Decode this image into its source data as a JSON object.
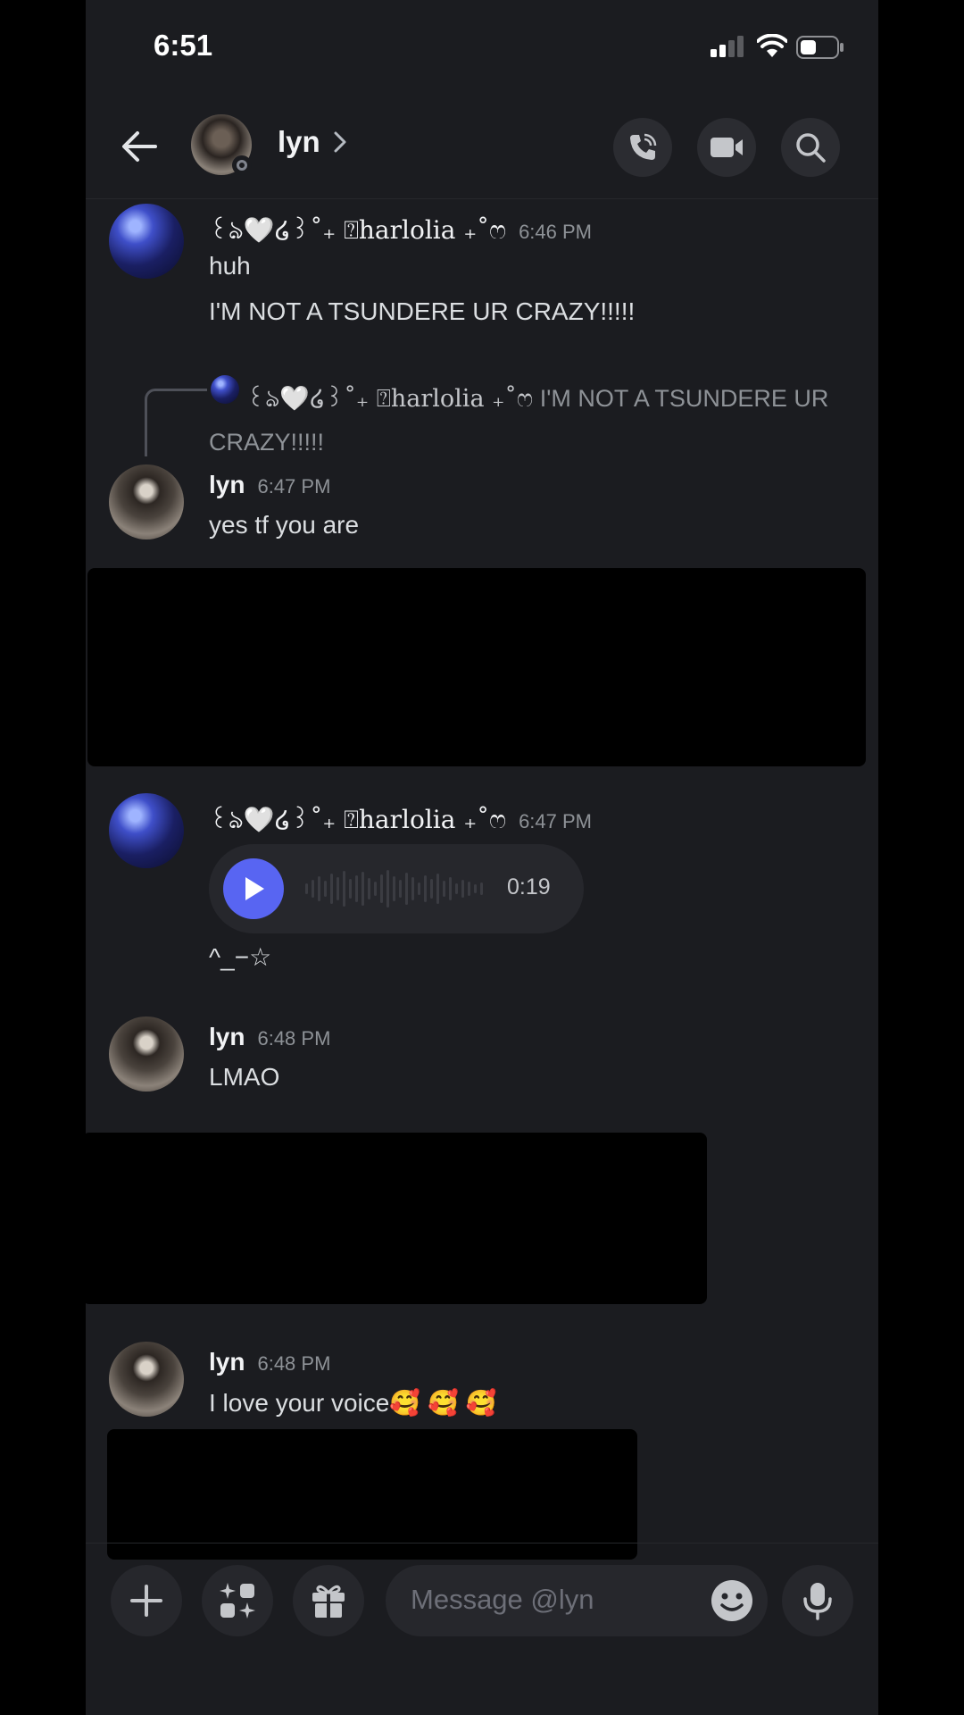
{
  "status_bar": {
    "time": "6:51"
  },
  "header": {
    "name": "lyn"
  },
  "messages": [
    {
      "author": "꒰ঌ🤍໒꒱˚₊ ⍰harlolia ₊˚ෆ",
      "time": "6:46 PM",
      "lines": [
        "huh",
        "I'M NOT A TSUNDERE UR CRAZY!!!!!"
      ]
    },
    {
      "reply_to": {
        "author": "꒰ঌ🤍໒꒱˚₊ ⍰harlolia ₊˚ෆ",
        "text": "I'M NOT A TSUNDERE UR CRAZY!!!!!"
      },
      "author": "lyn",
      "time": "6:47 PM",
      "lines": [
        "yes tf you are"
      ]
    },
    {
      "author": "꒰ঌ🤍໒꒱˚₊ ⍰harlolia ₊˚ෆ",
      "time": "6:47 PM",
      "voice_duration": "0:19",
      "lines": [
        "^_−☆"
      ]
    },
    {
      "author": "lyn",
      "time": "6:48 PM",
      "lines": [
        "LMAO"
      ]
    },
    {
      "author": "lyn",
      "time": "6:48 PM",
      "lines": [
        "I love your voice🥰 🥰 🥰"
      ]
    }
  ],
  "composer": {
    "placeholder": "Message @lyn"
  },
  "icons": [
    "back-arrow-icon",
    "chevron-right-icon",
    "phone-icon",
    "video-camera-icon",
    "search-icon",
    "plus-icon",
    "apps-icon",
    "gift-icon",
    "emoji-icon",
    "microphone-icon",
    "play-icon"
  ],
  "colors": {
    "background": "#1b1c20",
    "accent": "#5865f2",
    "text": "#dbdee1",
    "muted": "#8e9297"
  }
}
